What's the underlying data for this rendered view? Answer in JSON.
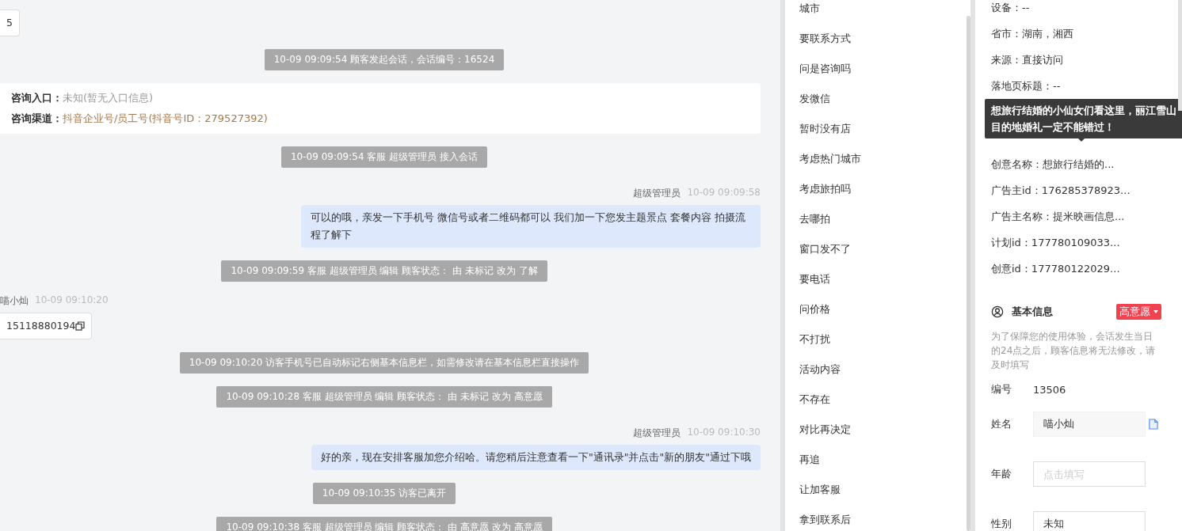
{
  "chat": {
    "messages": [
      {
        "kind": "visitor",
        "text": "5",
        "copyable": false
      },
      {
        "kind": "system",
        "text": "10-09 09:09:54 顾客发起会话，会话编号：16524"
      },
      {
        "kind": "info",
        "rows": [
          {
            "label": "咨询入口：",
            "value": "未知(暂无入口信息)",
            "color": "#999999"
          },
          {
            "label": "咨询渠道：",
            "value": "抖音企业号/员工号(抖音号ID：279527392)",
            "color": "#a57a4e"
          }
        ]
      },
      {
        "kind": "system",
        "text": "10-09 09:09:54 客服 超级管理员 接入会话"
      },
      {
        "kind": "agent",
        "sender": "超级管理员",
        "time": "10-09 09:09:58",
        "text": "可以的哦，亲发一下手机号 微信号或者二维码都可以 我们加一下您发主题景点 套餐内容 拍摄流程了解下"
      },
      {
        "kind": "system",
        "text": "10-09 09:09:59 客服 超级管理员 编辑 顾客状态： 由 未标记 改为 了解"
      },
      {
        "kind": "visitor",
        "sender": "喵小灿",
        "time": "10-09 09:10:20",
        "text": "15118880194",
        "copyable": true
      },
      {
        "kind": "system",
        "text": "10-09 09:10:20 访客手机号已自动标记右侧基本信息栏，如需修改请在基本信息栏直接操作"
      },
      {
        "kind": "system",
        "text": "10-09 09:10:28 客服 超级管理员 编辑 顾客状态： 由 未标记 改为 高意愿"
      },
      {
        "kind": "agent",
        "sender": "超级管理员",
        "time": "10-09 09:10:30",
        "text": "好的亲，现在安排客服加您介绍哈。请您稍后注意查看一下\"通讯录\"并点击\"新的朋友\"通过下哦"
      },
      {
        "kind": "system",
        "text": "10-09 09:10:35 访客已离开"
      },
      {
        "kind": "system",
        "text": "10-09 09:10:38 客服 超级管理员 编辑 顾客状态： 由 高意愿 改为 高意愿"
      }
    ]
  },
  "quick_replies": [
    "城市",
    "要联系方式",
    "问是咨询吗",
    "发微信",
    "暂时没有店",
    "考虑热门城市",
    "考虑旅拍吗",
    "去哪拍",
    "窗口发不了",
    "要电话",
    "问价格",
    "不打扰",
    "活动内容",
    "不存在",
    "对比再决定",
    "再追",
    "让加客服",
    "拿到联系后"
  ],
  "source_fields": [
    {
      "kind": "text",
      "text": "设备：--"
    },
    {
      "kind": "text",
      "text": "省市：湖南，湘西"
    },
    {
      "kind": "text",
      "text": "来源：直接访问"
    },
    {
      "kind": "text",
      "text": "落地页标题：--"
    },
    {
      "kind": "hidden"
    },
    {
      "kind": "hidden"
    },
    {
      "kind": "text",
      "text": "创意名称：想旅行结婚的..."
    },
    {
      "kind": "text",
      "text": "广告主id：176285378923..."
    },
    {
      "kind": "text",
      "text": "广告主名称：提米映画信息..."
    },
    {
      "kind": "text",
      "text": "计划id：177780109033..."
    },
    {
      "kind": "text",
      "text": "创意id：177780122029..."
    }
  ],
  "tooltip": "想旅行结婚的小仙女们看这里，丽江雪山目的地婚礼一定不能错过！",
  "basic_info": {
    "title": "基本信息",
    "intent_tag": "高意愿",
    "notice": "为了保障您的使用体验，会话发生当日的24点之后，顾客信息将无法修改，请及时填写",
    "fields": [
      {
        "kind": "text",
        "label": "编号",
        "value": "13506"
      },
      {
        "kind": "filled",
        "label": "姓名",
        "value": "喵小灿"
      },
      {
        "kind": "input",
        "label": "年龄",
        "placeholder": "点击填写"
      },
      {
        "kind": "input",
        "label": "性别",
        "value": "未知"
      }
    ]
  }
}
